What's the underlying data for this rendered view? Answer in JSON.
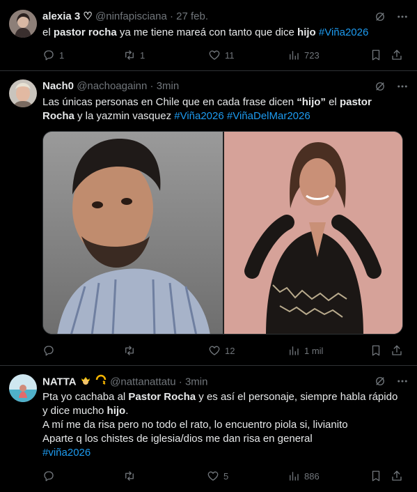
{
  "tweets": [
    {
      "name": "alexia 3 ♡",
      "handle": "@ninfapisciana",
      "time": "27 feb.",
      "text_parts": [
        "el ",
        "pastor rocha",
        " ya me tiene mareá con tanto que dice ",
        "hijo",
        " ",
        "#Viña2026"
      ],
      "replies": "1",
      "retweets": "1",
      "likes": "11",
      "views": "723"
    },
    {
      "name": "Nach0",
      "handle": "@nachoagainn",
      "time": "3min",
      "line1_parts": [
        "Las únicas personas en Chile que en cada frase dicen ",
        "“hijo”",
        " el ",
        "pastor"
      ],
      "line2_parts": [
        "Rocha",
        " y la yazmin vasquez ",
        "#Viña2026",
        " ",
        "#ViñaDelMar2026"
      ],
      "replies": "",
      "retweets": "",
      "likes": "12",
      "views": "1 mil"
    },
    {
      "name": "NATTA",
      "handle": "@nattanattatu",
      "time": "3min",
      "line1_parts": [
        "Pta yo cachaba al ",
        "Pastor Rocha",
        " y es así el personaje, siempre habla rápido"
      ],
      "line2_parts": [
        "y dice mucho ",
        "hijo",
        "."
      ],
      "line3": "A mí me da risa pero no todo el rato, lo encuentro piola si, livianito",
      "line4": "Aparte q los chistes de iglesia/dios me dan risa en general",
      "line5": "#viña2026",
      "replies": "",
      "retweets": "",
      "likes": "5",
      "views": "886"
    }
  ],
  "sep": "·",
  "colors": {
    "link": "#1d9bf0",
    "muted": "#71767b",
    "bg": "#000000",
    "border": "#2f3336"
  }
}
